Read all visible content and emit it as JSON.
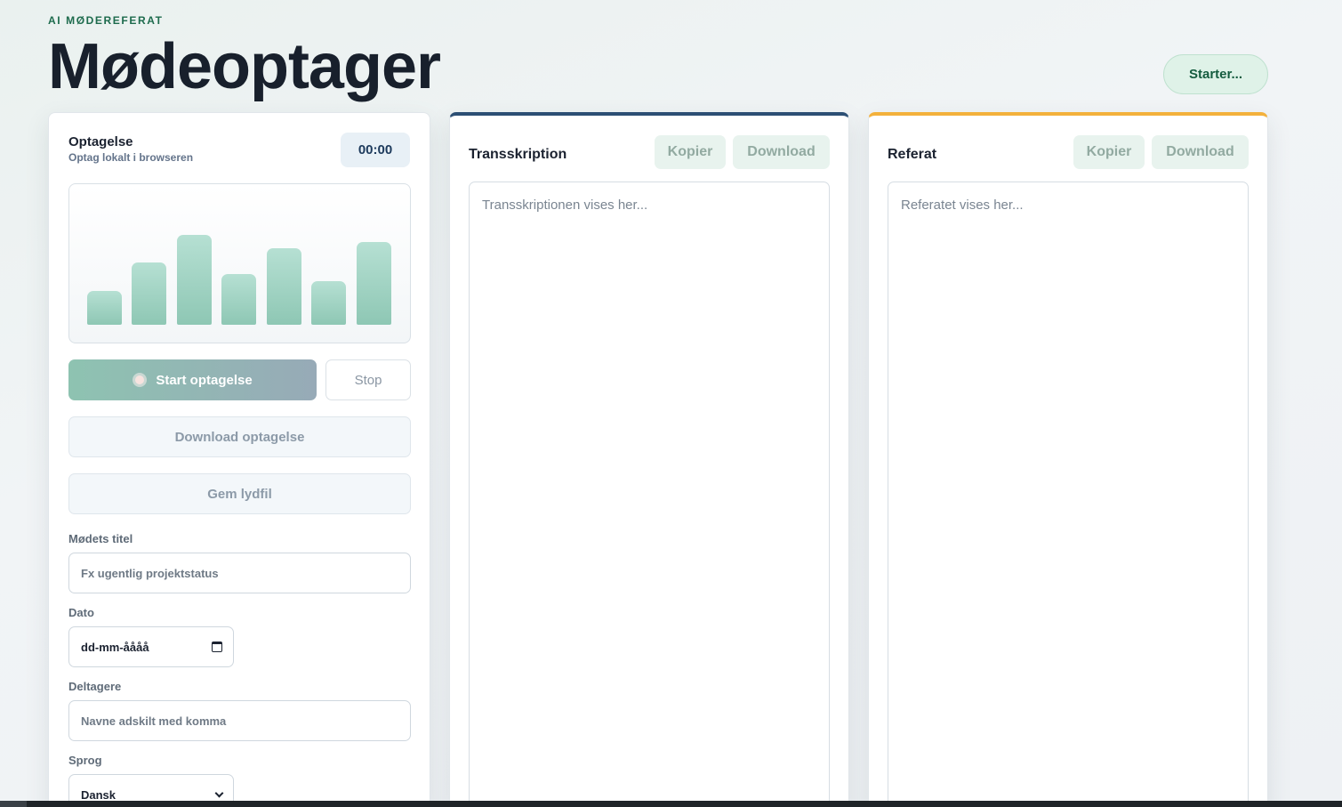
{
  "header": {
    "eyebrow": "AI MØDEREFERAT",
    "title": "Mødeoptager",
    "status_button": "Starter..."
  },
  "recording": {
    "title": "Optagelse",
    "subtitle": "Optag lokalt i browseren",
    "timer": "00:00",
    "level_bars": [
      0.2,
      0.37,
      0.53,
      0.3,
      0.45,
      0.26,
      0.49
    ],
    "start_label": "Start optagelse",
    "stop_label": "Stop",
    "download_label": "Download optagelse",
    "save_label": "Gem lydfil",
    "meeting_title_label": "Mødets titel",
    "meeting_title_placeholder": "Fx ugentlig projektstatus",
    "date_label": "Dato",
    "date_placeholder": "dd-mm-åååå",
    "participants_label": "Deltagere",
    "participants_placeholder": "Navne adskilt med komma",
    "language_label": "Sprog",
    "language_value": "Dansk"
  },
  "transcription": {
    "title": "Transskription",
    "copy_label": "Kopier",
    "download_label": "Download",
    "placeholder": "Transskriptionen vises her...",
    "accent": "#2c4f74"
  },
  "summary": {
    "title": "Referat",
    "copy_label": "Kopier",
    "download_label": "Download",
    "placeholder": "Referatet vises her...",
    "accent": "#f3b13c"
  }
}
